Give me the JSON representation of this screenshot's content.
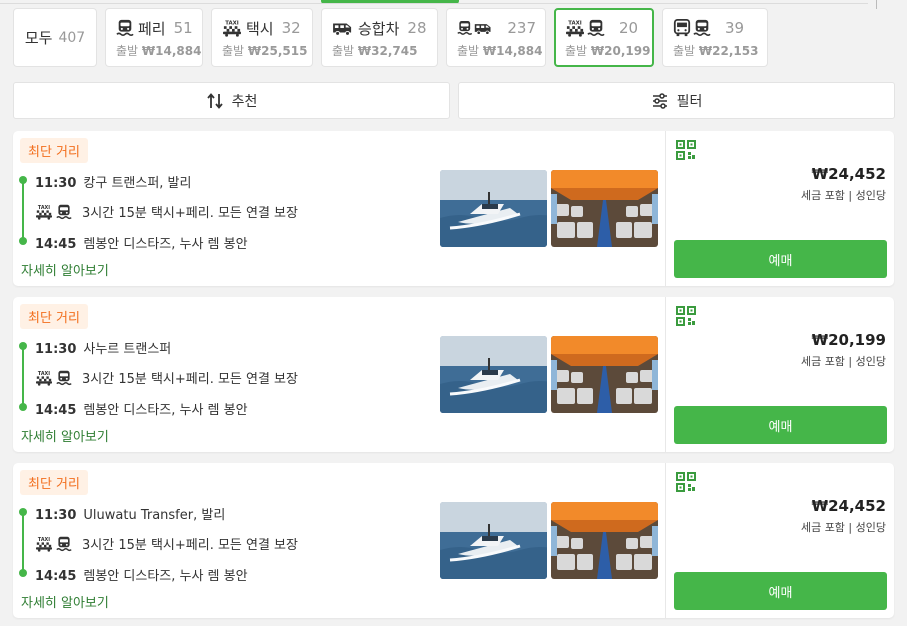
{
  "filters": [
    {
      "name": "모두",
      "count": "407",
      "price": ""
    },
    {
      "name": "페리",
      "count": "51",
      "price_prefix": "출발",
      "price": "₩14,884",
      "icons": [
        "ferry-icon"
      ]
    },
    {
      "name": "택시",
      "count": "32",
      "price_prefix": "출발",
      "price": "₩25,515",
      "icons": [
        "taxi-icon"
      ]
    },
    {
      "name": "승합차",
      "count": "28",
      "price_prefix": "출발",
      "price": "₩32,745",
      "icons": [
        "van-icon"
      ]
    },
    {
      "name": "",
      "count": "237",
      "price_prefix": "출발",
      "price": "₩14,884",
      "icons": [
        "ferry-icon",
        "van-icon"
      ]
    },
    {
      "name": "",
      "count": "20",
      "price_prefix": "출발",
      "price": "₩20,199",
      "icons": [
        "taxi-icon",
        "ferry-icon"
      ],
      "active": true
    },
    {
      "name": "",
      "count": "39",
      "price_prefix": "출발",
      "price": "₩22,153",
      "icons": [
        "bus-icon",
        "ferry-icon"
      ]
    }
  ],
  "sort": {
    "label": "추천"
  },
  "filter_button": {
    "label": "필터"
  },
  "results": [
    {
      "badge": "최단 거리",
      "depart_time": "11:30",
      "depart_place": "캉구 트랜스퍼, 발리",
      "duration": "3시간 15분 택시+페리. 모든 연결 보장",
      "arrive_time": "14:45",
      "arrive_place": "렘봉안 디스타즈, 누사 렘 봉안",
      "more": "자세히 알아보기",
      "price": "₩24,452",
      "tax_note": "세금 포함 | 성인당",
      "book": "예매"
    },
    {
      "badge": "최단 거리",
      "depart_time": "11:30",
      "depart_place": "사누르 트랜스퍼",
      "duration": "3시간 15분 택시+페리. 모든 연결 보장",
      "arrive_time": "14:45",
      "arrive_place": "렘봉안 디스타즈, 누사 렘 봉안",
      "more": "자세히 알아보기",
      "price": "₩20,199",
      "tax_note": "세금 포함 | 성인당",
      "book": "예매"
    },
    {
      "badge": "최단 거리",
      "depart_time": "11:30",
      "depart_place": "Uluwatu Transfer, 발리",
      "duration": "3시간 15분 택시+페리. 모든 연결 보장",
      "arrive_time": "14:45",
      "arrive_place": "렘봉안 디스타즈, 누사 렘 봉안",
      "more": "자세히 알아보기",
      "price": "₩24,452",
      "tax_note": "세금 포함 | 성인당",
      "book": "예매"
    }
  ],
  "colors": {
    "accent": "#45b649",
    "badge_text": "#f26e1d",
    "badge_bg": "#fff1e5",
    "link": "#2e7d32"
  }
}
